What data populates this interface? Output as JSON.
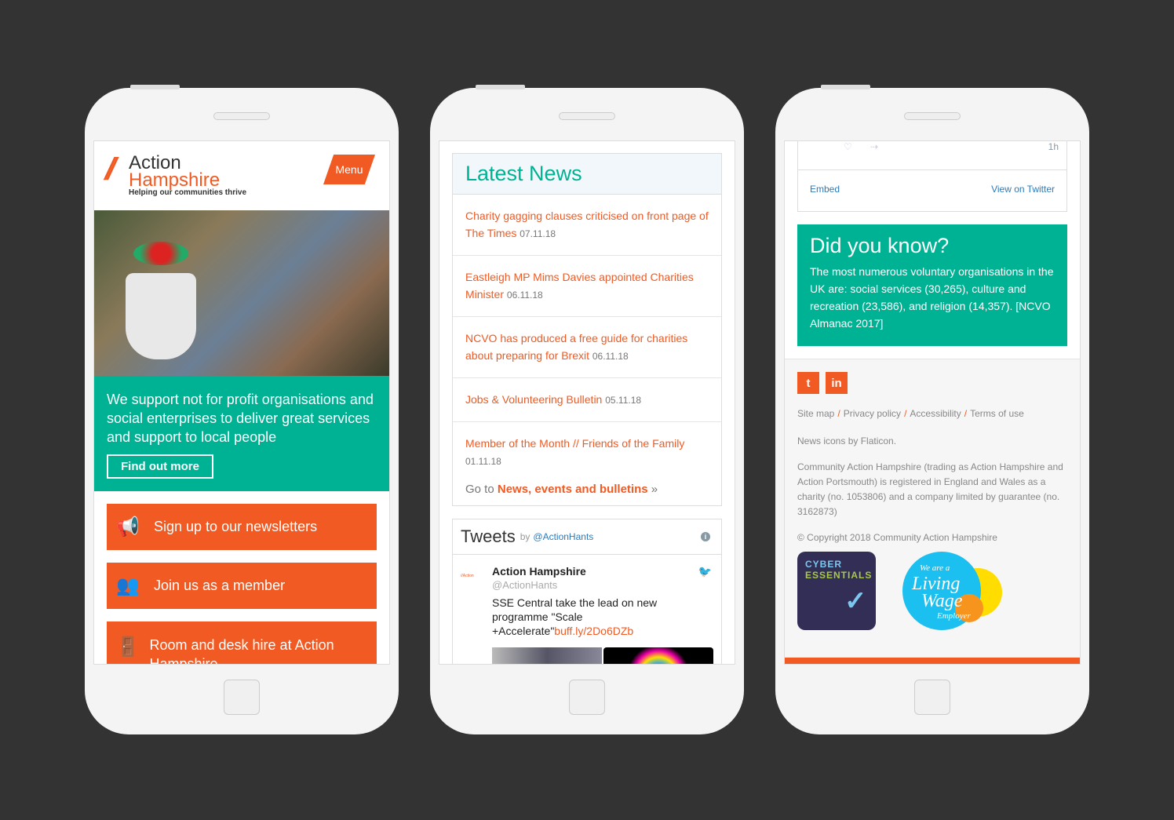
{
  "phone1": {
    "logo": {
      "line1": "Action",
      "line2": "Hampshire",
      "tagline": "Helping our communities thrive"
    },
    "menu_label": "Menu",
    "hero_text": "We support not for profit organisations and social enterprises to deliver great services and support to local people",
    "hero_button": "Find out more",
    "ctas": [
      {
        "icon": "megaphone-icon",
        "label": "Sign up to our newsletters"
      },
      {
        "icon": "people-icon",
        "label": "Join us as a member"
      },
      {
        "icon": "door-icon",
        "label": "Room and desk hire at Action Hampshire"
      }
    ]
  },
  "phone2": {
    "news_title": "Latest News",
    "news": [
      {
        "title": "Charity gagging clauses criticised on front page of The Times",
        "date": "07.11.18"
      },
      {
        "title": "Eastleigh MP Mims Davies appointed Charities Minister",
        "date": "06.11.18"
      },
      {
        "title": "NCVO has produced a free guide for charities about preparing for Brexit",
        "date": "06.11.18"
      },
      {
        "title": "Jobs & Volunteering Bulletin",
        "date": "05.11.18"
      },
      {
        "title": "Member of the Month // Friends of the Family",
        "date": "01.11.18"
      }
    ],
    "goto_prefix": "Go to",
    "goto_link": "News, events and bulletins",
    "goto_suffix": "»",
    "tweets": {
      "title": "Tweets",
      "by": "by",
      "handle": "@ActionHants",
      "author": "Action Hampshire",
      "author_handle": "@ActionHants",
      "text": "SSE Central take the lead on new programme \"Scale +Accelerate\"",
      "link": "buff.ly/2Do6DZb"
    }
  },
  "phone3": {
    "tweet_time": "1h",
    "embed": "Embed",
    "view_on_twitter": "View on Twitter",
    "dyk_title": "Did you know?",
    "dyk_text": "The most numerous voluntary organisations in the UK are: social services (30,265), culture and recreation (23,586), and religion (14,357). [NCVO Almanac 2017]",
    "social": [
      {
        "icon": "twitter-icon",
        "label": "t"
      },
      {
        "icon": "linkedin-icon",
        "label": "in"
      }
    ],
    "links": [
      "Site map",
      "Privacy policy",
      "Accessibility",
      "Terms of use"
    ],
    "credits": "News icons by Flaticon.",
    "legal": "Community Action Hampshire (trading as Action Hampshire and Action Portsmouth) is registered in England and Wales as a charity (no. 1053806) and a company limited by guarantee (no. 3162873)",
    "copyright": "© Copyright 2018 Community Action Hampshire",
    "badge_cyber": {
      "line1": "CYBER",
      "line2": "ESSENTIALS"
    },
    "badge_lw": {
      "l1": "We are a",
      "l2": "Living",
      "l3": "Wage",
      "l4": "Employer"
    }
  },
  "colors": {
    "brand_orange": "#f15a22",
    "teal": "#00b294",
    "background": "#333333"
  }
}
